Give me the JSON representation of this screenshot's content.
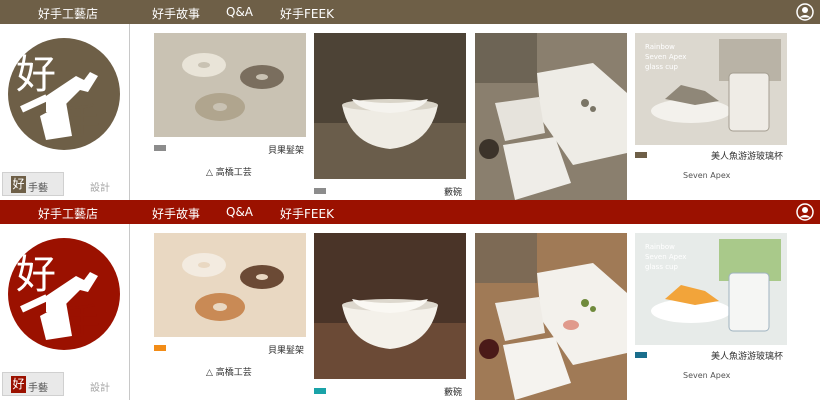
{
  "nav": {
    "shop_name": "好手工藝店",
    "links": [
      "好手故事",
      "Q&A",
      "好手FEEK"
    ]
  },
  "sidebar": {
    "logo_chars": [
      "好",
      "手"
    ],
    "brand_tag": {
      "chip": "好",
      "label": "手藝"
    },
    "design_link": "設計"
  },
  "products": [
    {
      "caption": "貝果髮架",
      "maker": "高橋工芸"
    },
    {
      "caption": "藪碗"
    },
    {
      "caption": ""
    },
    {
      "caption": "美人魚游游玻璃杯",
      "photo_text": "Rainbow\nSeven Apex\nglass cup",
      "maker": "Seven Apex"
    }
  ],
  "variants": [
    {
      "name": "sepia",
      "nav_color": "#6e5f47",
      "ribbon_colors": [
        "#8c8c8c",
        "#8c8c8c",
        "#6e5f47"
      ]
    },
    {
      "name": "color",
      "nav_color": "#9b1100",
      "ribbon_colors": [
        "#f28c17",
        "#1aa3a8",
        "#1a6e8c"
      ]
    }
  ]
}
